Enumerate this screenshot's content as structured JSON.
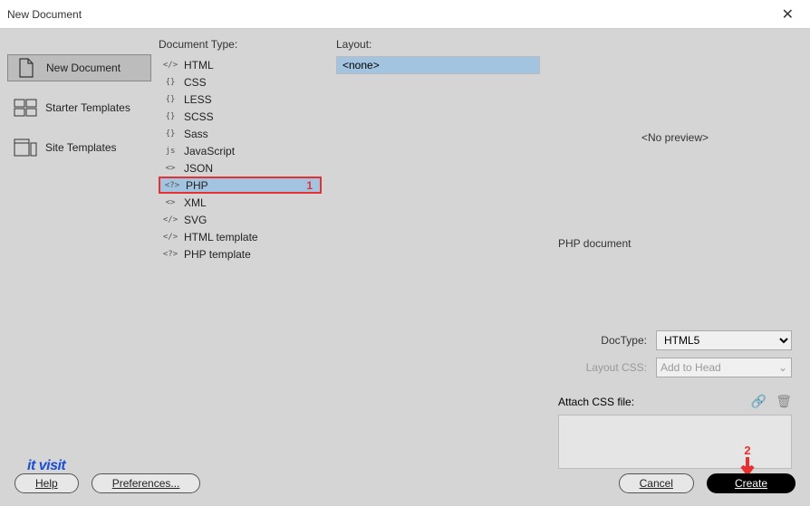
{
  "window": {
    "title": "New Document"
  },
  "sidebar": {
    "items": [
      {
        "label": "New Document",
        "selected": true
      },
      {
        "label": "Starter Templates",
        "selected": false
      },
      {
        "label": "Site Templates",
        "selected": false
      }
    ]
  },
  "doctype": {
    "heading": "Document Type:",
    "items": [
      {
        "icon": "</>",
        "label": "HTML"
      },
      {
        "icon": "{}",
        "label": "CSS"
      },
      {
        "icon": "{}",
        "label": "LESS"
      },
      {
        "icon": "{}",
        "label": "SCSS"
      },
      {
        "icon": "{}",
        "label": "Sass"
      },
      {
        "icon": "js",
        "label": "JavaScript"
      },
      {
        "icon": "<>",
        "label": "JSON"
      },
      {
        "icon": "<?>",
        "label": "PHP",
        "selected": true,
        "annotation": "1"
      },
      {
        "icon": "<>",
        "label": "XML"
      },
      {
        "icon": "</>",
        "label": "SVG"
      },
      {
        "icon": "</>",
        "label": "HTML template"
      },
      {
        "icon": "<?>",
        "label": "PHP template"
      }
    ]
  },
  "layout": {
    "heading": "Layout:",
    "items": [
      {
        "label": "<none>",
        "selected": true
      }
    ]
  },
  "preview": {
    "no_preview": "<No preview>",
    "description": "PHP document"
  },
  "form": {
    "doctype_label": "DocType:",
    "doctype_value": "HTML5",
    "layoutcss_label": "Layout CSS:",
    "layoutcss_value": "Add to Head",
    "attach_label": "Attach CSS file:"
  },
  "annotations": {
    "arrow_number": "2"
  },
  "branding": {
    "logo": "it visit"
  },
  "footer": {
    "help": "Help",
    "preferences": "Preferences...",
    "cancel": "Cancel",
    "create": "Create"
  }
}
